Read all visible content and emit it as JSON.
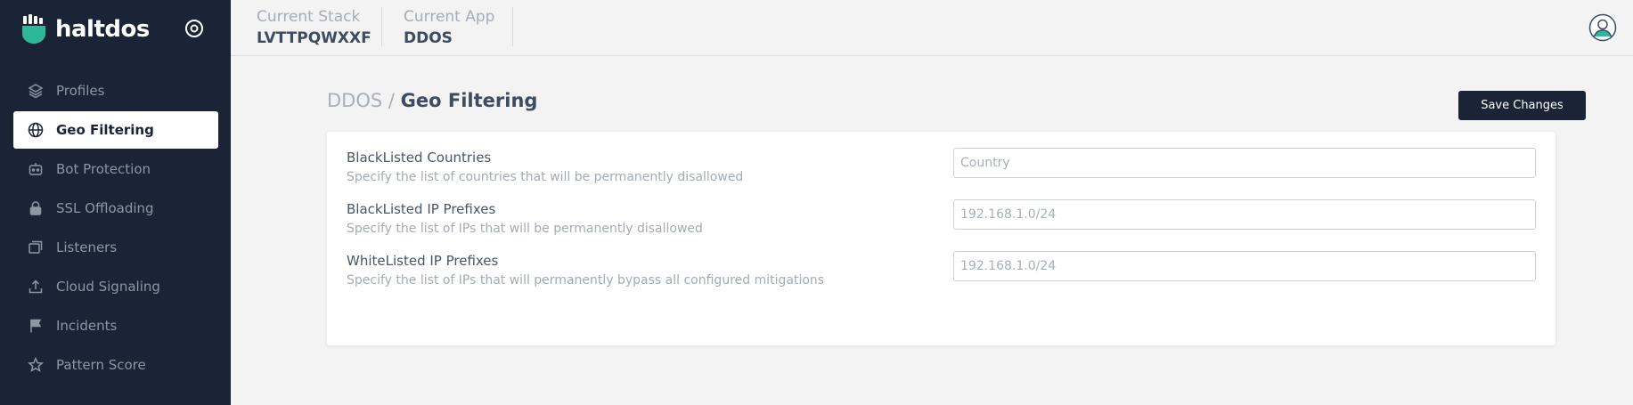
{
  "brand": {
    "name": "haltdos"
  },
  "sidebar": {
    "items": [
      {
        "label": "Profiles",
        "icon": "layers-icon",
        "active": false
      },
      {
        "label": "Geo Filtering",
        "icon": "globe-icon",
        "active": true
      },
      {
        "label": "Bot Protection",
        "icon": "robot-icon",
        "active": false
      },
      {
        "label": "SSL Offloading",
        "icon": "lock-icon",
        "active": false
      },
      {
        "label": "Listeners",
        "icon": "windows-icon",
        "active": false
      },
      {
        "label": "Cloud Signaling",
        "icon": "upload-icon",
        "active": false
      },
      {
        "label": "Incidents",
        "icon": "flag-icon",
        "active": false
      },
      {
        "label": "Pattern Score",
        "icon": "star-icon",
        "active": false
      }
    ]
  },
  "header": {
    "stack": {
      "label": "Current Stack",
      "value": "LVTTPQWXXF"
    },
    "app": {
      "label": "Current App",
      "value": "DDOS"
    }
  },
  "page": {
    "breadcrumb_parent": "DDOS",
    "breadcrumb_separator": "/",
    "breadcrumb_current": "Geo Filtering",
    "save_label": "Save Changes"
  },
  "form": {
    "rows": [
      {
        "title": "BlackListed Countries",
        "description": "Specify the list of countries that will be permanently disallowed",
        "placeholder": "Country",
        "value": ""
      },
      {
        "title": "BlackListed IP Prefixes",
        "description": "Specify the list of IPs that will be permanently disallowed",
        "placeholder": "192.168.1.0/24",
        "value": ""
      },
      {
        "title": "WhiteListed IP Prefixes",
        "description": "Specify the list of IPs that will permanently bypass all configured mitigations",
        "placeholder": "192.168.1.0/24",
        "value": ""
      }
    ]
  },
  "colors": {
    "sidebar_bg": "#1b2436",
    "accent_green": "#2fb79a",
    "button_bg": "#1b2436",
    "page_bg": "#f2f3f2"
  }
}
